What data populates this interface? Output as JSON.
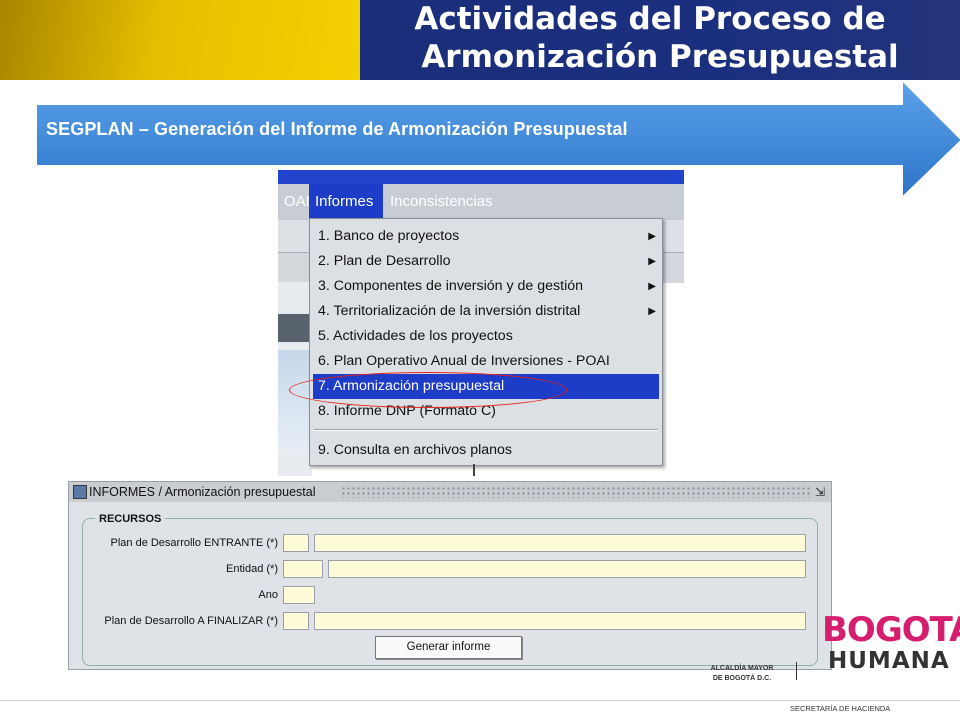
{
  "header": {
    "title_line1": "Actividades del Proceso de",
    "title_line2": "Armonización Presupuestal",
    "colors": {
      "gold": "#f5d000",
      "blue": "#1b2f7f"
    }
  },
  "banner": {
    "text": "SEGPLAN – Generación del Informe de Armonización Presupuestal",
    "color": "#3b82d6"
  },
  "menubar": {
    "items": [
      "OAI",
      "Informes",
      "Inconsistencias"
    ],
    "active": "Informes"
  },
  "dropdown": {
    "items": [
      {
        "label": "1. Banco de proyectos",
        "submenu": true
      },
      {
        "label": "2. Plan de Desarrollo",
        "submenu": true
      },
      {
        "label": "3. Componentes de inversión y de gestión",
        "submenu": true
      },
      {
        "label": "4. Territorialización de la inversión distrital",
        "submenu": true
      },
      {
        "label": "5. Actividades de los proyectos",
        "submenu": false
      },
      {
        "label": "6. Plan Operativo Anual de Inversiones - POAI",
        "submenu": false
      },
      {
        "label": "7. Armonización presupuestal",
        "submenu": false,
        "selected": true
      },
      {
        "label": "8. Informe DNP (Formato C)",
        "submenu": false
      },
      {
        "label": "9. Consulta en archivos planos",
        "submenu": false
      }
    ],
    "submenu_glyph": "▶"
  },
  "form": {
    "window_title": "INFORMES / Armonización presupuestal",
    "maximize_glyph": "⇲",
    "group_label": "RECURSOS",
    "fields": [
      {
        "label": "Plan de Desarrollo ENTRANTE (*)",
        "code": "",
        "description": ""
      },
      {
        "label": "Entidad (*)",
        "code": "",
        "description": ""
      },
      {
        "label": "Ano",
        "code": ""
      },
      {
        "label": "Plan de Desarrollo A FINALIZAR (*)",
        "code": "",
        "description": ""
      }
    ],
    "button_label": "Generar informe"
  },
  "branding": {
    "logo_line1": "BOGOTÁ",
    "logo_line2": "HUMANA",
    "alcaldia_line1": "ALCALDÍA MAYOR",
    "alcaldia_line2": "DE BOGOTÁ D.C.",
    "footer": "SECRETARÍA DE HACIENDA"
  }
}
